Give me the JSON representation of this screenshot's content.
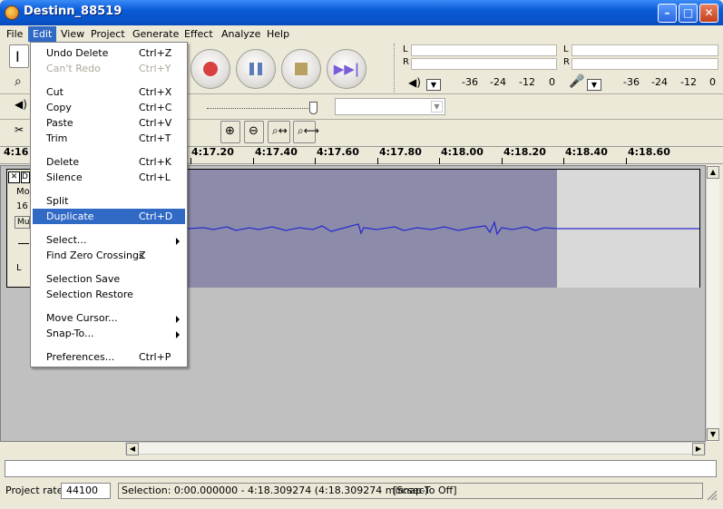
{
  "window": {
    "title": "Destinn_88519"
  },
  "menubar": [
    "File",
    "Edit",
    "View",
    "Project",
    "Generate",
    "Effect",
    "Analyze",
    "Help"
  ],
  "edit_menu": [
    {
      "label": "Undo Delete",
      "accel": "Ctrl+Z"
    },
    {
      "label": "Can't Redo",
      "accel": "Ctrl+Y",
      "disabled": true
    },
    {
      "label": "Cut",
      "accel": "Ctrl+X"
    },
    {
      "label": "Copy",
      "accel": "Ctrl+C"
    },
    {
      "label": "Paste",
      "accel": "Ctrl+V"
    },
    {
      "label": "Trim",
      "accel": "Ctrl+T"
    },
    {
      "label": "Delete",
      "accel": "Ctrl+K"
    },
    {
      "label": "Silence",
      "accel": "Ctrl+L"
    },
    {
      "label": "Split",
      "accel": ""
    },
    {
      "label": "Duplicate",
      "accel": "Ctrl+D",
      "highlighted": true
    },
    {
      "label": "Select...",
      "accel": "",
      "submenu": true
    },
    {
      "label": "Find Zero Crossings",
      "accel": "Z"
    },
    {
      "label": "Selection Save",
      "accel": ""
    },
    {
      "label": "Selection Restore",
      "accel": ""
    },
    {
      "label": "Move Cursor...",
      "accel": "",
      "submenu": true
    },
    {
      "label": "Snap-To...",
      "accel": "",
      "submenu": true
    },
    {
      "label": "Preferences...",
      "accel": "Ctrl+P"
    }
  ],
  "meters": {
    "play": {
      "l": "L",
      "r": "R",
      "scale": [
        "-36",
        "-24",
        "-12",
        "0"
      ]
    },
    "record": {
      "l": "L",
      "r": "R",
      "scale": [
        "-36",
        "-24",
        "-12",
        "0"
      ]
    }
  },
  "ruler": {
    "ticks": [
      "4:16",
      "4:17.20",
      "4:17.40",
      "4:17.60",
      "4:17.80",
      "4:18.00",
      "4:18.20",
      "4:18.40",
      "4:18.60"
    ]
  },
  "track": {
    "close": "✕",
    "name_stub": "D",
    "mute": "Mu",
    "info1": "Mo",
    "info2": "16",
    "gain_l": "L"
  },
  "status": {
    "rate_label": "Project rate:",
    "rate_value": "44100",
    "selection": "Selection: 0:00.000000 - 4:18.309274 (4:18.309274 min:sec)",
    "snap": "[Snap-To Off]"
  },
  "colors": {
    "accent": "#316ac5",
    "waveform": "#2b2bd0",
    "selection": "#8c8caa"
  }
}
